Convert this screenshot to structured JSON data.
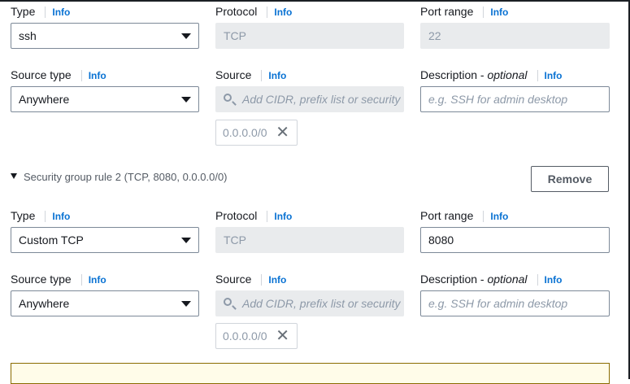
{
  "info_link": "Info",
  "rule1": {
    "type_label": "Type",
    "type_value": "ssh",
    "protocol_label": "Protocol",
    "protocol_value": "TCP",
    "port_label": "Port range",
    "port_value": "22",
    "source_type_label": "Source type",
    "source_type_value": "Anywhere",
    "source_label": "Source",
    "source_placeholder": "Add CIDR, prefix list or security",
    "source_token": "0.0.0.0/0",
    "desc_label": "Description - ",
    "desc_label_optional": "optional",
    "desc_placeholder": "e.g. SSH for admin desktop"
  },
  "rule2": {
    "header": "Security group rule 2 (TCP, 8080, 0.0.0.0/0)",
    "remove_label": "Remove",
    "type_label": "Type",
    "type_value": "Custom TCP",
    "protocol_label": "Protocol",
    "protocol_value": "TCP",
    "port_label": "Port range",
    "port_value": "8080",
    "source_type_label": "Source type",
    "source_type_value": "Anywhere",
    "source_label": "Source",
    "source_placeholder": "Add CIDR, prefix list or security",
    "source_token": "0.0.0.0/0",
    "desc_label": "Description - ",
    "desc_label_optional": "optional",
    "desc_placeholder": "e.g. SSH for admin desktop"
  },
  "colors": {
    "info_link": "#0972d3",
    "warning_bg": "#fffce9",
    "warning_border": "#8a6b00"
  }
}
